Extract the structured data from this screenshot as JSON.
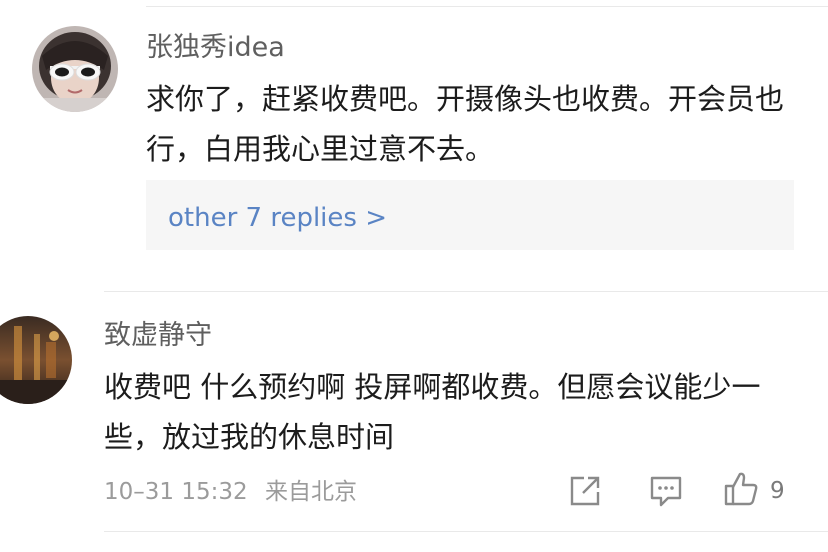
{
  "comments": [
    {
      "username": "张独秀idea",
      "text": "求你了，赶紧收费吧。开摄像头也收费。开会员也行，白用我心里过意不去。",
      "avatar_icon": "avatar-sunglasses-girl",
      "replies_link": "other 7 replies >"
    },
    {
      "username": "致虚静守",
      "text": "收费吧 什么预约啊 投屏啊都收费。但愿会议能少一些，放过我的休息时间",
      "avatar_icon": "avatar-night-photo",
      "timestamp": "10–31 15:32",
      "source": "来自北京",
      "actions": {
        "share_icon": "share-icon",
        "comment_icon": "comment-icon",
        "like_icon": "thumbs-up-icon",
        "like_count": "9"
      }
    }
  ],
  "colors": {
    "username": "#5f5f5f",
    "text": "#1c1c1c",
    "link": "#5a84c4",
    "meta": "#9b9b9b",
    "reply_bg": "#f6f6f6"
  }
}
